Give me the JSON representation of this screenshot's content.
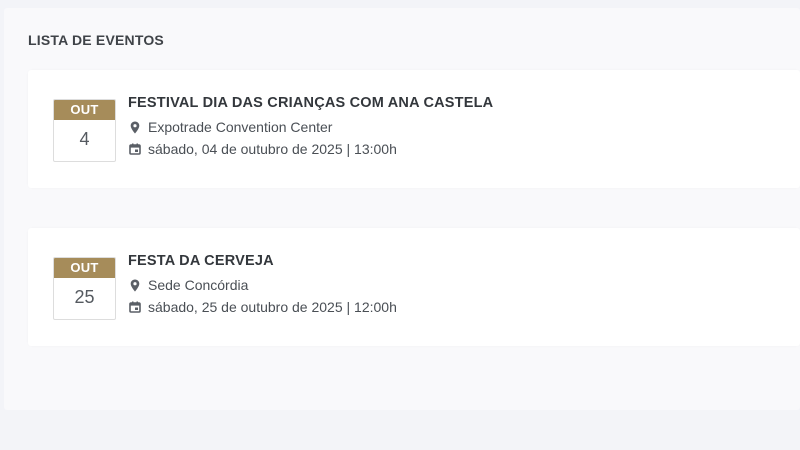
{
  "list": {
    "title": "LISTA DE EVENTOS",
    "events": [
      {
        "month": "OUT",
        "day": "4",
        "title": "FESTIVAL DIA DAS CRIANÇAS COM ANA CASTELA",
        "location": "Expotrade Convention Center",
        "datetime": "sábado, 04 de outubro de 2025 | 13:00h"
      },
      {
        "month": "OUT",
        "day": "25",
        "title": "FESTA DA CERVEJA",
        "location": "Sede Concórdia",
        "datetime": "sábado, 25 de outubro de 2025 | 12:00h"
      }
    ]
  },
  "icons": {
    "location": "map-marker-icon",
    "date": "calendar-icon"
  },
  "colors": {
    "accent": "#a68c5a",
    "text": "#33373c",
    "background": "#f3f4f8"
  }
}
